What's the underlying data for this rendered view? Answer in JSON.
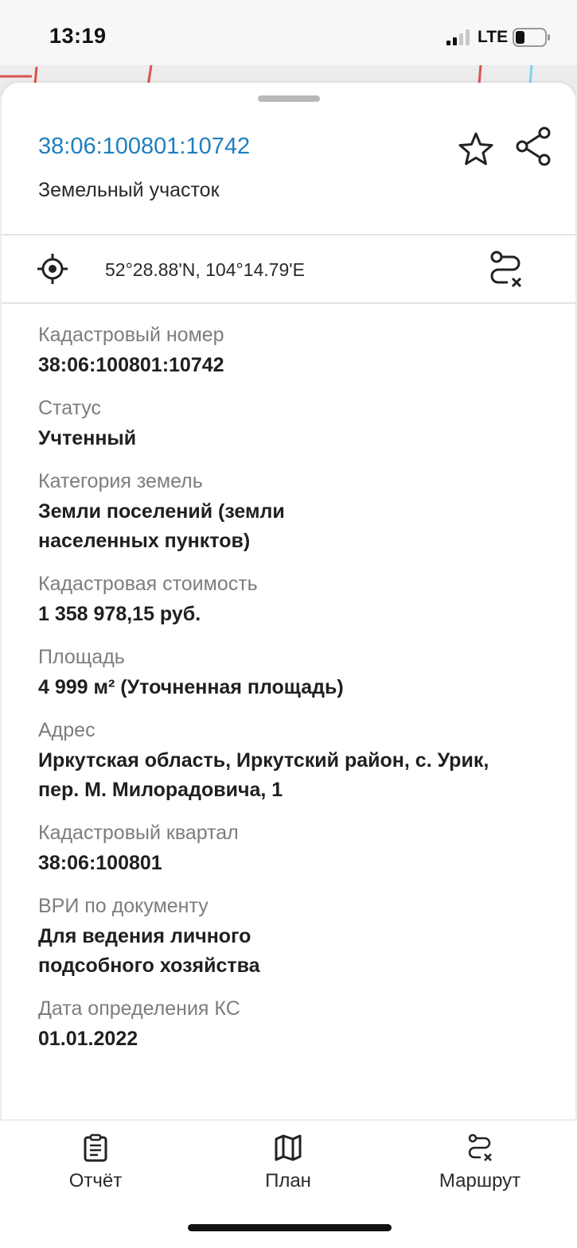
{
  "status_bar": {
    "time": "13:19",
    "network": "LTE",
    "icons": [
      "signal-icon",
      "battery-icon"
    ]
  },
  "header": {
    "cadastral_number": "38:06:100801:10742",
    "object_type": "Земельный участок",
    "icons": [
      "star-icon",
      "share-icon"
    ]
  },
  "location": {
    "coordinates": "52°28.88'N, 104°14.79'E",
    "icons": [
      "locate-icon",
      "route-icon"
    ]
  },
  "fields": [
    {
      "label": "Кадастровый номер",
      "value": "38:06:100801:10742"
    },
    {
      "label": "Статус",
      "value": "Учтенный"
    },
    {
      "label": "Категория земель",
      "value": "Земли поселений (земли населенных пунктов)"
    },
    {
      "label": "Кадастровая стоимость",
      "value": "1 358 978,15 руб."
    },
    {
      "label": "Площадь",
      "value": "4 999 м² (Уточненная площадь)"
    },
    {
      "label": "Адрес",
      "value": "Иркутская область, Иркутский район, с. Урик, пер. М. Милорадовича, 1"
    },
    {
      "label": "Кадастровый квартал",
      "value": "38:06:100801"
    },
    {
      "label": "ВРИ по документу",
      "value": "Для ведения личного подсобного хозяйства"
    },
    {
      "label": "Дата определения КС",
      "value": "01.01.2022"
    }
  ],
  "bottom_tabs": [
    {
      "label": "Отчёт",
      "icon": "report-icon"
    },
    {
      "label": "План",
      "icon": "map-icon"
    },
    {
      "label": "Маршрут",
      "icon": "route-icon"
    }
  ],
  "colors": {
    "accent": "#1f7fbf",
    "label_gray": "#7d7d7d",
    "text": "#1f1f1f",
    "map_red": "#d9534f",
    "map_blue": "#7fd1e8"
  }
}
